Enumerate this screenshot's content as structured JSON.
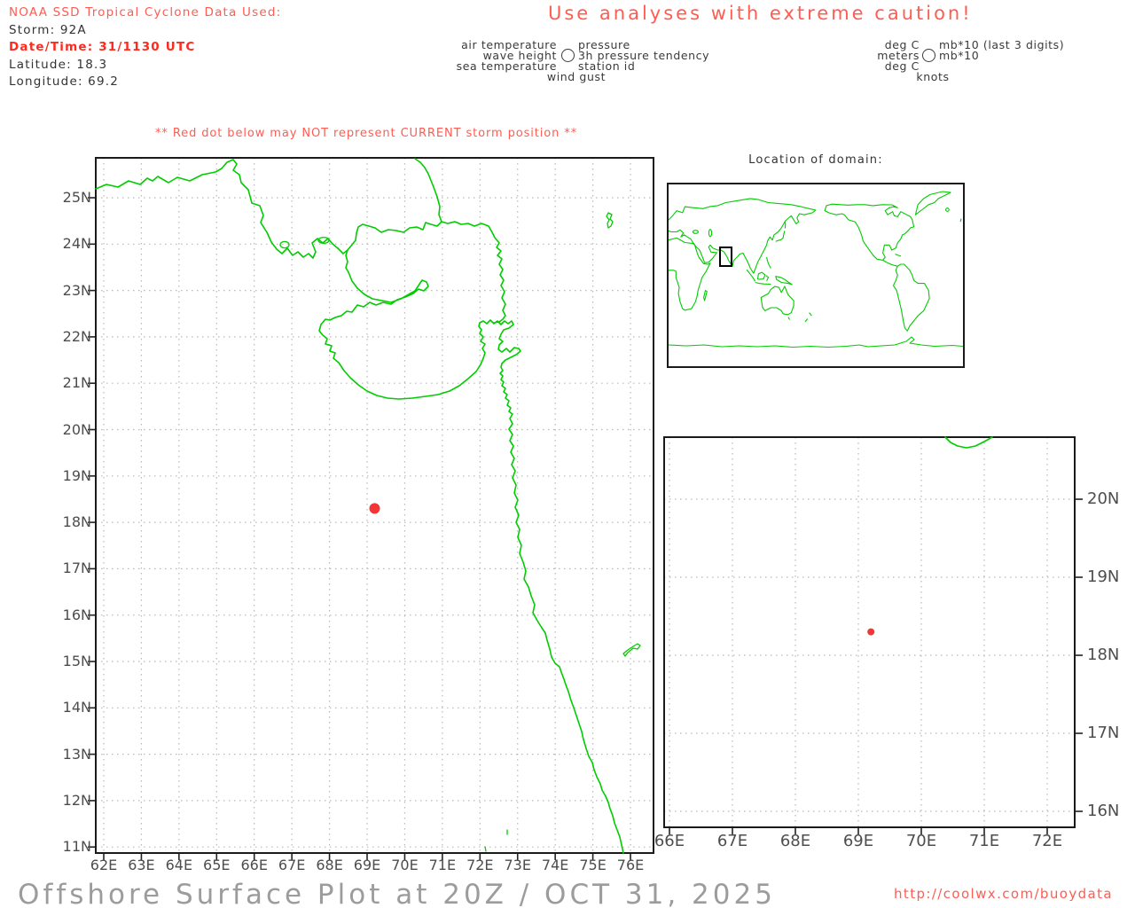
{
  "header": {
    "source_line": "NOAA SSD Tropical Cyclone Data Used:",
    "storm": "Storm: 92A",
    "datetime": "Date/Time: 31/1130 UTC",
    "latitude": "Latitude: 18.3",
    "longitude": "Longitude: 69.2"
  },
  "caution_banner": "Use analyses with extreme caution!",
  "station_model_legend": {
    "left": [
      "air temperature",
      "wave height",
      "sea temperature"
    ],
    "right": [
      "pressure",
      "3h pressure tendency",
      "station id"
    ],
    "bottom": "wind gust",
    "icon": "station-circle"
  },
  "units_legend": {
    "left": [
      "deg C",
      "meters",
      "deg C"
    ],
    "right": [
      "mb*10 (last 3 digits)",
      "mb*10"
    ],
    "bottom": "knots",
    "icon": "station-circle"
  },
  "warning": "** Red dot below may NOT represent CURRENT storm position **",
  "storm_position": {
    "lat": 18.3,
    "lon": 69.2
  },
  "main_map": {
    "lat_labels": [
      "25N",
      "24N",
      "23N",
      "22N",
      "21N",
      "20N",
      "19N",
      "18N",
      "17N",
      "16N",
      "15N",
      "14N",
      "13N",
      "12N",
      "11N"
    ],
    "lon_labels": [
      "62E",
      "63E",
      "64E",
      "65E",
      "66E",
      "67E",
      "68E",
      "69E",
      "70E",
      "71E",
      "72E",
      "73E",
      "74E",
      "75E",
      "76E"
    ]
  },
  "inset_map": {
    "title": "Location of domain:"
  },
  "zoom_map": {
    "lat_labels": [
      "20N",
      "19N",
      "18N",
      "17N",
      "16N"
    ],
    "lon_labels": [
      "66E",
      "67E",
      "68E",
      "69E",
      "70E",
      "71E",
      "72E"
    ]
  },
  "footer": {
    "title": "Offshore Surface Plot at 20Z / OCT 31, 2025",
    "url": "http://coolwx.com/buoydata"
  },
  "colors": {
    "coastline": "#00cc00",
    "salmon": "#ff5c52",
    "alert_red": "#ff2a1f",
    "text_dark": "#333333",
    "axis_label": "#4d4d4d",
    "storm_dot": "#f23636",
    "footer_gray": "#9c9c9c",
    "grid_dot": "#b8b8b8"
  }
}
